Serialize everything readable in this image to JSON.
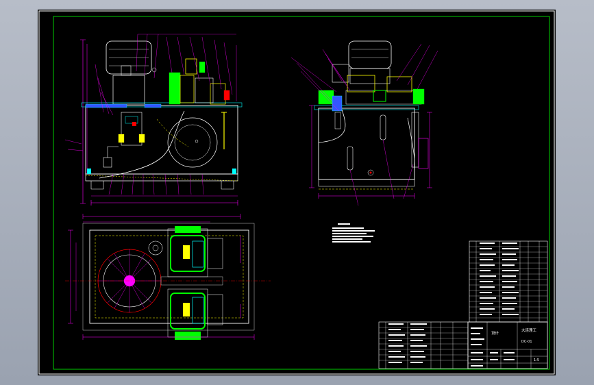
{
  "title_block": {
    "company_label": "大连理工",
    "drawing_code": "DC-01",
    "designer_label": "设计",
    "scale_label": "1:5"
  },
  "colors": {
    "background": "#000000",
    "frame": "#ffffff",
    "border_green": "#00ff00",
    "magenta": "#ff00ff",
    "cyan": "#00ffff",
    "yellow": "#ffff00",
    "green": "#00ff00",
    "red": "#ff0000",
    "white": "#ffffff",
    "blue": "#3355ff"
  }
}
